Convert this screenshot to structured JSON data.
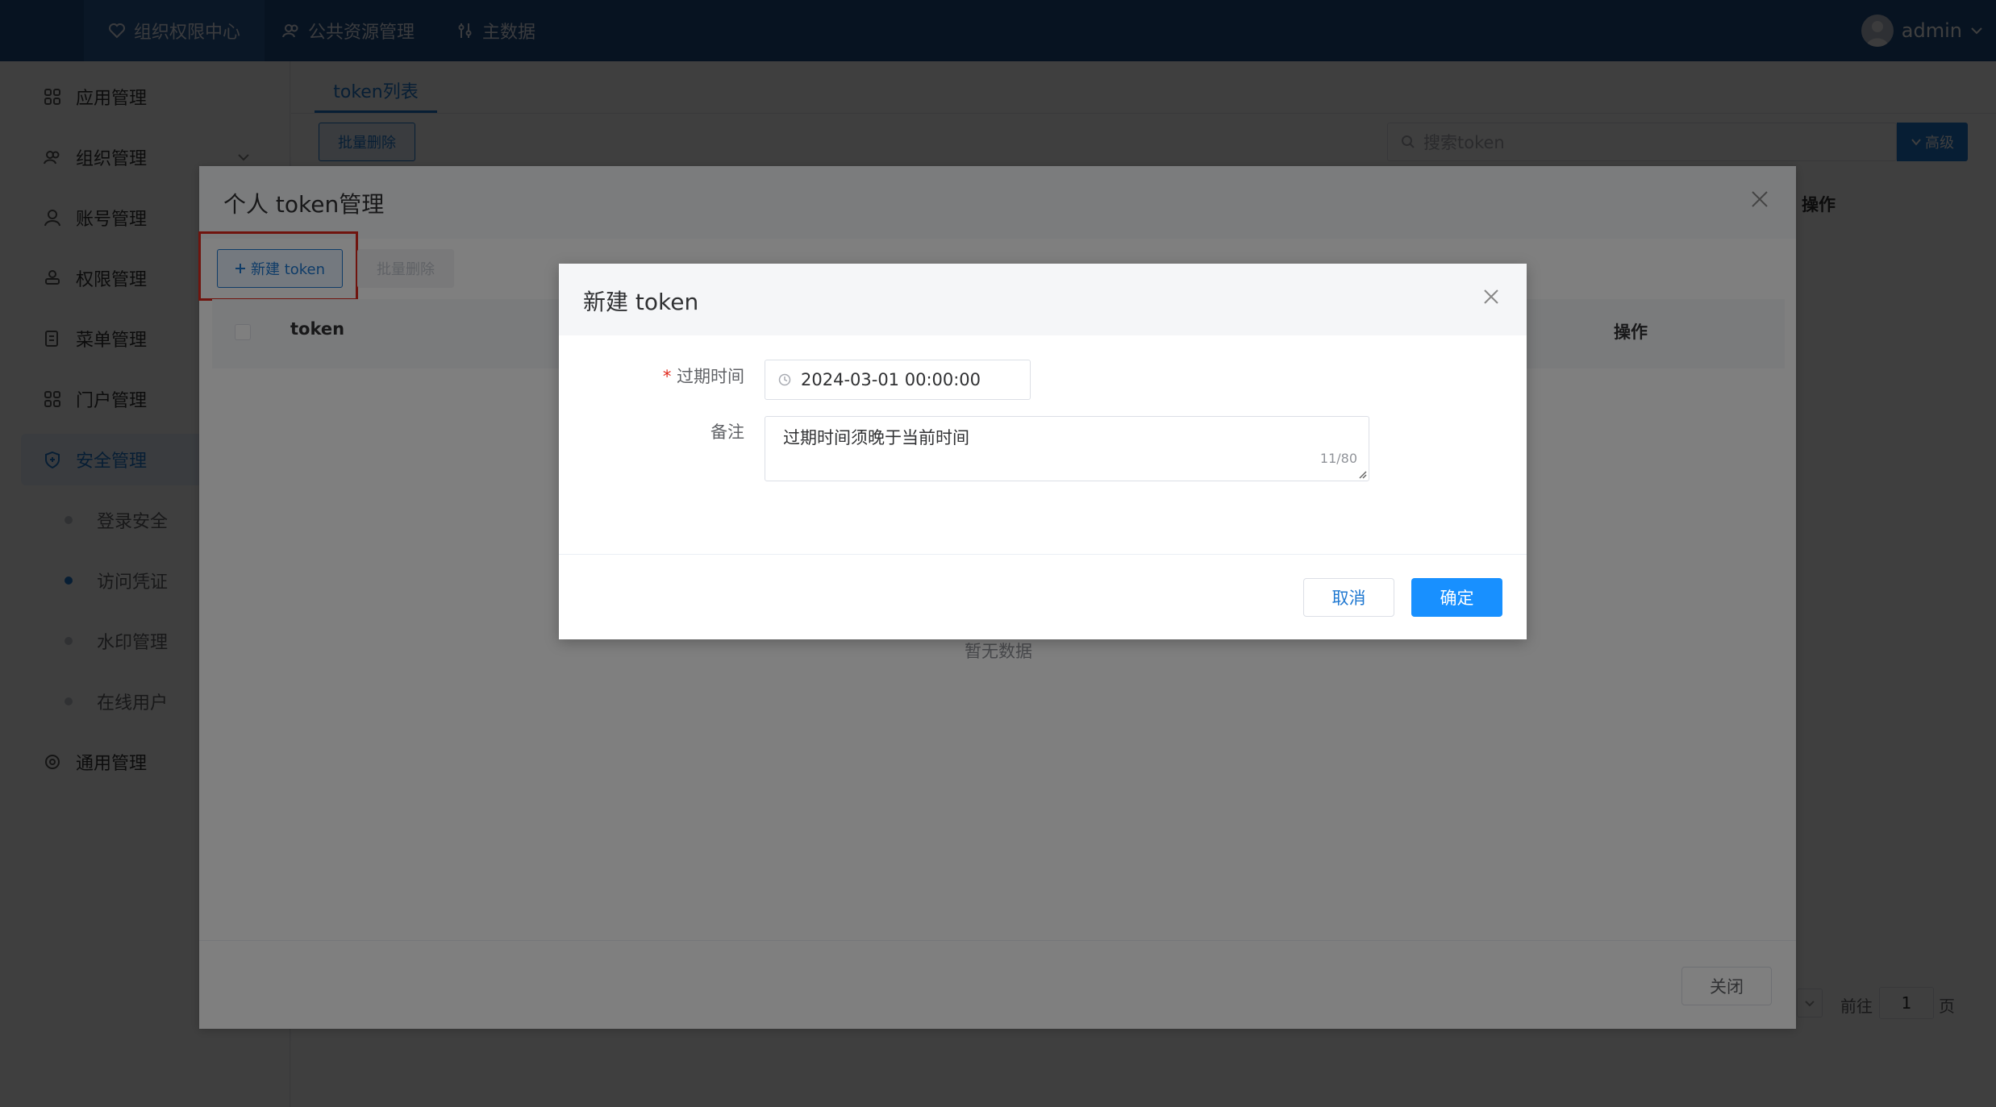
{
  "topnav": {
    "items": [
      {
        "label": "组织权限中心"
      },
      {
        "label": "公共资源管理"
      },
      {
        "label": "主数据"
      }
    ],
    "user": "admin"
  },
  "sidebar": {
    "items": [
      {
        "label": "应用管理"
      },
      {
        "label": "组织管理"
      },
      {
        "label": "账号管理"
      },
      {
        "label": "权限管理"
      },
      {
        "label": "菜单管理"
      },
      {
        "label": "门户管理"
      },
      {
        "label": "安全管理"
      },
      {
        "label": "通用管理"
      }
    ],
    "subitems": [
      {
        "label": "登录安全"
      },
      {
        "label": "访问凭证"
      },
      {
        "label": "水印管理"
      },
      {
        "label": "在线用户"
      }
    ]
  },
  "main": {
    "tab": "token列表",
    "batch_delete": "批量删除",
    "search_placeholder": "搜索token",
    "advanced": "高级",
    "column_action": "操作",
    "pagination": {
      "goto": "前往",
      "page": "1",
      "page_unit": "页"
    }
  },
  "dialog_personal": {
    "title": "个人 token管理",
    "new_token": "新建 token",
    "batch_delete": "批量删除",
    "columns": {
      "token": "token",
      "action": "操作"
    },
    "empty": "暂无数据",
    "close": "关闭"
  },
  "dialog_new": {
    "title": "新建 token",
    "expire_label": "过期时间",
    "required_mark": "*",
    "expire_value": "2024-03-01 00:00:00",
    "remark_label": "备注",
    "remark_value": "过期时间须晚于当前时间",
    "remark_count": "11/80",
    "cancel": "取消",
    "confirm": "确定"
  },
  "colors": {
    "nav": "#1f4d85",
    "primary": "#1f78d1",
    "highlight": "#e0291d"
  }
}
